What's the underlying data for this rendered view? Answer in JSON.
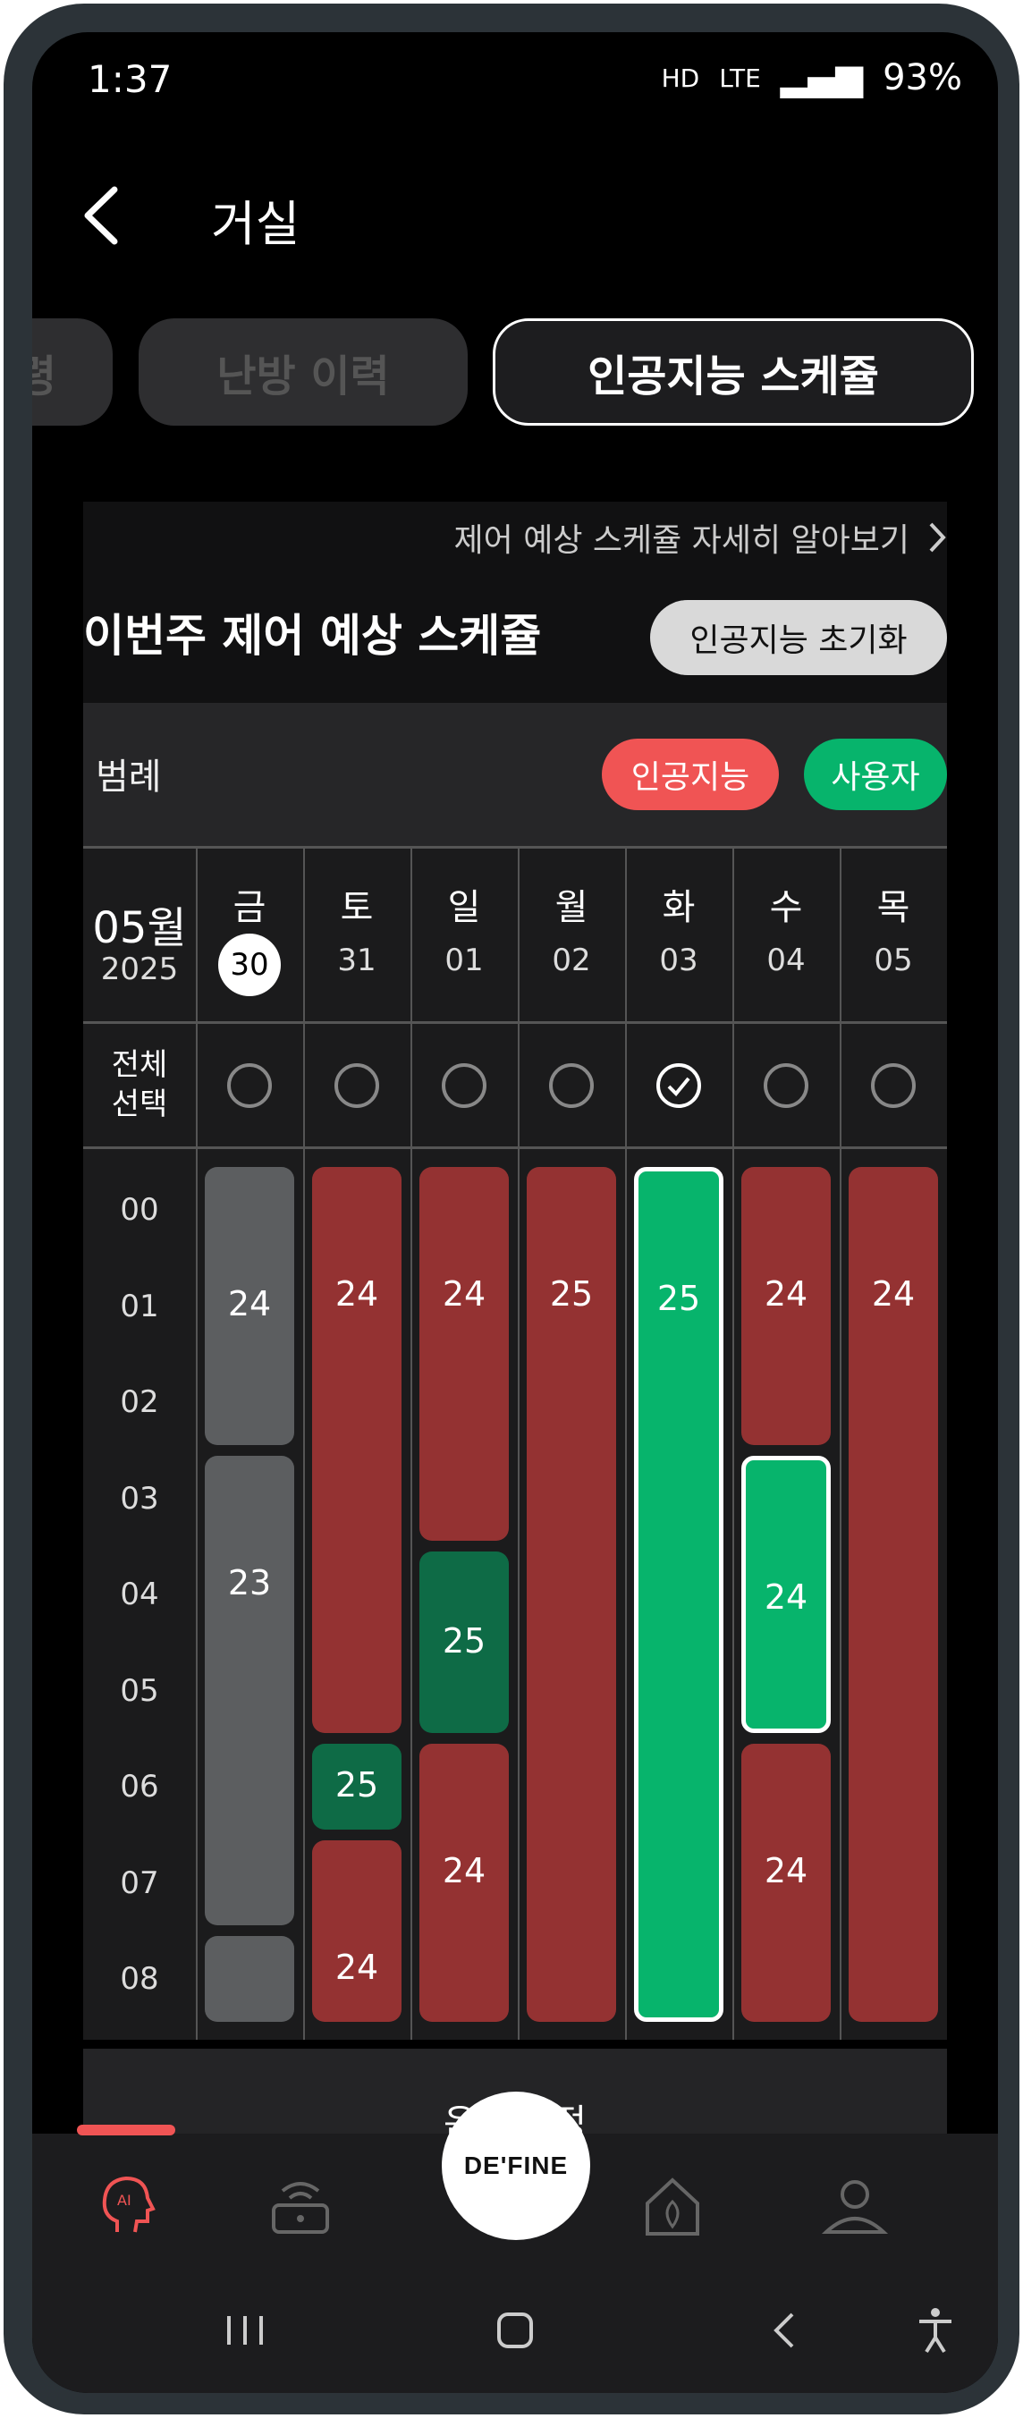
{
  "status_bar": {
    "time": "1:37",
    "battery": "93%",
    "network": "LTE",
    "hd": "HD"
  },
  "header": {
    "title": "거실"
  },
  "tabs": [
    {
      "label": "령"
    },
    {
      "label": "난방 이력"
    },
    {
      "label": "인공지능 스케쥴"
    }
  ],
  "panel": {
    "more_link": "제어 예상 스케쥴 자세히 알아보기",
    "week_title": "이번주 제어 예상 스케쥴",
    "reset_button": "인공지능 초기화"
  },
  "legend": {
    "label": "범례",
    "ai": "인공지능",
    "user": "사용자"
  },
  "calendar": {
    "month": "05월",
    "year": "2025",
    "select_all": "전체\n선택",
    "days": [
      {
        "name": "금",
        "num": "30",
        "selected_date": true,
        "checked": false
      },
      {
        "name": "토",
        "num": "31",
        "selected_date": false,
        "checked": false
      },
      {
        "name": "일",
        "num": "01",
        "selected_date": false,
        "checked": false
      },
      {
        "name": "월",
        "num": "02",
        "selected_date": false,
        "checked": false
      },
      {
        "name": "화",
        "num": "03",
        "selected_date": false,
        "checked": true
      },
      {
        "name": "수",
        "num": "04",
        "selected_date": false,
        "checked": false
      },
      {
        "name": "목",
        "num": "05",
        "selected_date": false,
        "checked": false
      }
    ],
    "hours": [
      "00",
      "01",
      "02",
      "03",
      "04",
      "05",
      "06",
      "07",
      "08"
    ],
    "schedule": [
      [
        {
          "start": 0,
          "end": 3,
          "temp": "24",
          "kind": "gray"
        },
        {
          "start": 3,
          "end": 8,
          "temp": "23",
          "kind": "gray"
        },
        {
          "start": 8,
          "end": 9,
          "temp": "",
          "kind": "gray"
        }
      ],
      [
        {
          "start": 0,
          "end": 6,
          "temp": "24",
          "kind": "red"
        },
        {
          "start": 6,
          "end": 7,
          "temp": "25",
          "kind": "dgreen"
        },
        {
          "start": 7,
          "end": 9,
          "temp": "24",
          "kind": "red"
        }
      ],
      [
        {
          "start": 0,
          "end": 4,
          "temp": "24",
          "kind": "red"
        },
        {
          "start": 4,
          "end": 6,
          "temp": "25",
          "kind": "dgreen"
        },
        {
          "start": 6,
          "end": 9,
          "temp": "24",
          "kind": "red"
        }
      ],
      [
        {
          "start": 0,
          "end": 9,
          "temp": "25",
          "kind": "red"
        }
      ],
      [
        {
          "start": 0,
          "end": 9,
          "temp": "25",
          "kind": "green",
          "outline": true
        }
      ],
      [
        {
          "start": 0,
          "end": 3,
          "temp": "24",
          "kind": "red"
        },
        {
          "start": 3,
          "end": 6,
          "temp": "24",
          "kind": "green",
          "outline": true
        },
        {
          "start": 6,
          "end": 9,
          "temp": "24",
          "kind": "red"
        }
      ],
      [
        {
          "start": 0,
          "end": 9,
          "temp": "24",
          "kind": "red"
        }
      ]
    ]
  },
  "adjust_button": "온도 조정",
  "bottom_nav": {
    "center_logo": "DE'FINE"
  },
  "colors": {
    "ai": "#f05454",
    "user": "#07b46c",
    "red": "#943232",
    "gray": "#5c5e60"
  }
}
